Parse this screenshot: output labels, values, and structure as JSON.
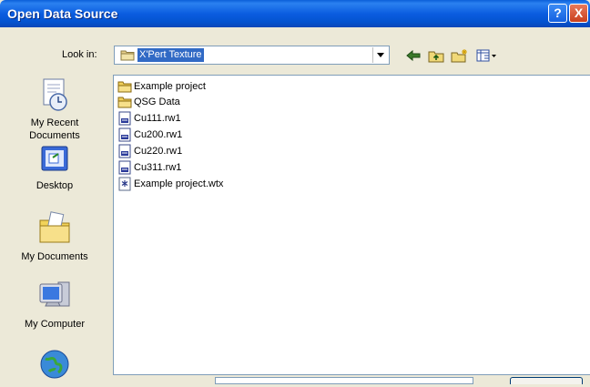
{
  "window": {
    "title": "Open Data Source",
    "help_button": "?",
    "close_button": "X"
  },
  "lookin": {
    "label": "Look in:",
    "value": "X'Pert Texture"
  },
  "toolbar": {
    "back_icon": "back-arrow-icon",
    "up_icon": "up-folder-icon",
    "new_folder_icon": "new-folder-icon",
    "views_icon": "views-menu-icon"
  },
  "places": [
    {
      "label": "My Recent\nDocuments",
      "icon": "recent-documents-icon"
    },
    {
      "label": "Desktop",
      "icon": "desktop-icon"
    },
    {
      "label": "My Documents",
      "icon": "my-documents-icon"
    },
    {
      "label": "My Computer",
      "icon": "my-computer-icon"
    },
    {
      "label": "",
      "icon": "network-places-icon"
    }
  ],
  "files": [
    {
      "name": "Example project",
      "type": "folder"
    },
    {
      "name": "QSG Data",
      "type": "folder"
    },
    {
      "name": "Cu111.rw1",
      "type": "data"
    },
    {
      "name": "Cu200.rw1",
      "type": "data"
    },
    {
      "name": "Cu220.rw1",
      "type": "data"
    },
    {
      "name": "Cu311.rw1",
      "type": "data"
    },
    {
      "name": "Example project.wtx",
      "type": "project"
    }
  ],
  "colors": {
    "titlebar": "#0a5fd9",
    "selection": "#316ac5",
    "folder": "#f5d66b"
  }
}
